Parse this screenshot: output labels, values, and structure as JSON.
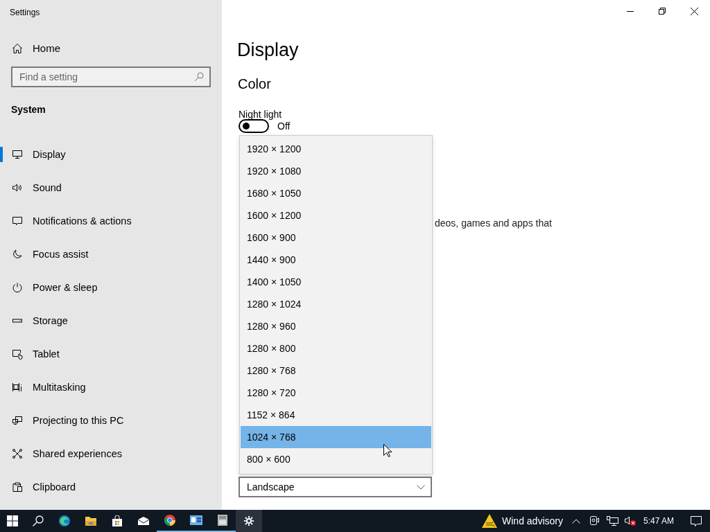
{
  "window": {
    "title": "Settings"
  },
  "sidebar": {
    "home": "Home",
    "search": {
      "placeholder": "Find a setting"
    },
    "section": "System",
    "items": [
      {
        "label": "Display",
        "selected": true
      },
      {
        "label": "Sound",
        "selected": false
      },
      {
        "label": "Notifications & actions",
        "selected": false
      },
      {
        "label": "Focus assist",
        "selected": false
      },
      {
        "label": "Power & sleep",
        "selected": false
      },
      {
        "label": "Storage",
        "selected": false
      },
      {
        "label": "Tablet",
        "selected": false
      },
      {
        "label": "Multitasking",
        "selected": false
      },
      {
        "label": "Projecting to this PC",
        "selected": false
      },
      {
        "label": "Shared experiences",
        "selected": false
      },
      {
        "label": "Clipboard",
        "selected": false
      }
    ]
  },
  "main": {
    "title": "Display",
    "section": "Color",
    "night_light": {
      "label": "Night light",
      "on": false,
      "state_text": "Off"
    },
    "partial_text": "deos, games and apps that",
    "orientation": {
      "value": "Landscape"
    },
    "resolution_options": [
      {
        "label": "1920 × 1200",
        "selected": false
      },
      {
        "label": "1920 × 1080",
        "selected": false
      },
      {
        "label": "1680 × 1050",
        "selected": false
      },
      {
        "label": "1600 × 1200",
        "selected": false
      },
      {
        "label": "1600 × 900",
        "selected": false
      },
      {
        "label": "1440 × 900",
        "selected": false
      },
      {
        "label": "1400 × 1050",
        "selected": false
      },
      {
        "label": "1280 × 1024",
        "selected": false
      },
      {
        "label": "1280 × 960",
        "selected": false
      },
      {
        "label": "1280 × 800",
        "selected": false
      },
      {
        "label": "1280 × 768",
        "selected": false
      },
      {
        "label": "1280 × 720",
        "selected": false
      },
      {
        "label": "1152 × 864",
        "selected": false
      },
      {
        "label": "1024 × 768",
        "selected": true
      },
      {
        "label": "800 × 600",
        "selected": false
      }
    ]
  },
  "taskbar": {
    "apps": [
      {
        "running": false,
        "active": false
      },
      {
        "running": false,
        "active": false
      },
      {
        "running": false,
        "active": false
      },
      {
        "running": false,
        "active": false
      },
      {
        "running": true,
        "active": false
      },
      {
        "running": true,
        "active": false
      },
      {
        "running": true,
        "active": false
      },
      {
        "running": false,
        "active": true
      }
    ],
    "weather": "Wind advisory",
    "clock": "5:47 AM"
  }
}
